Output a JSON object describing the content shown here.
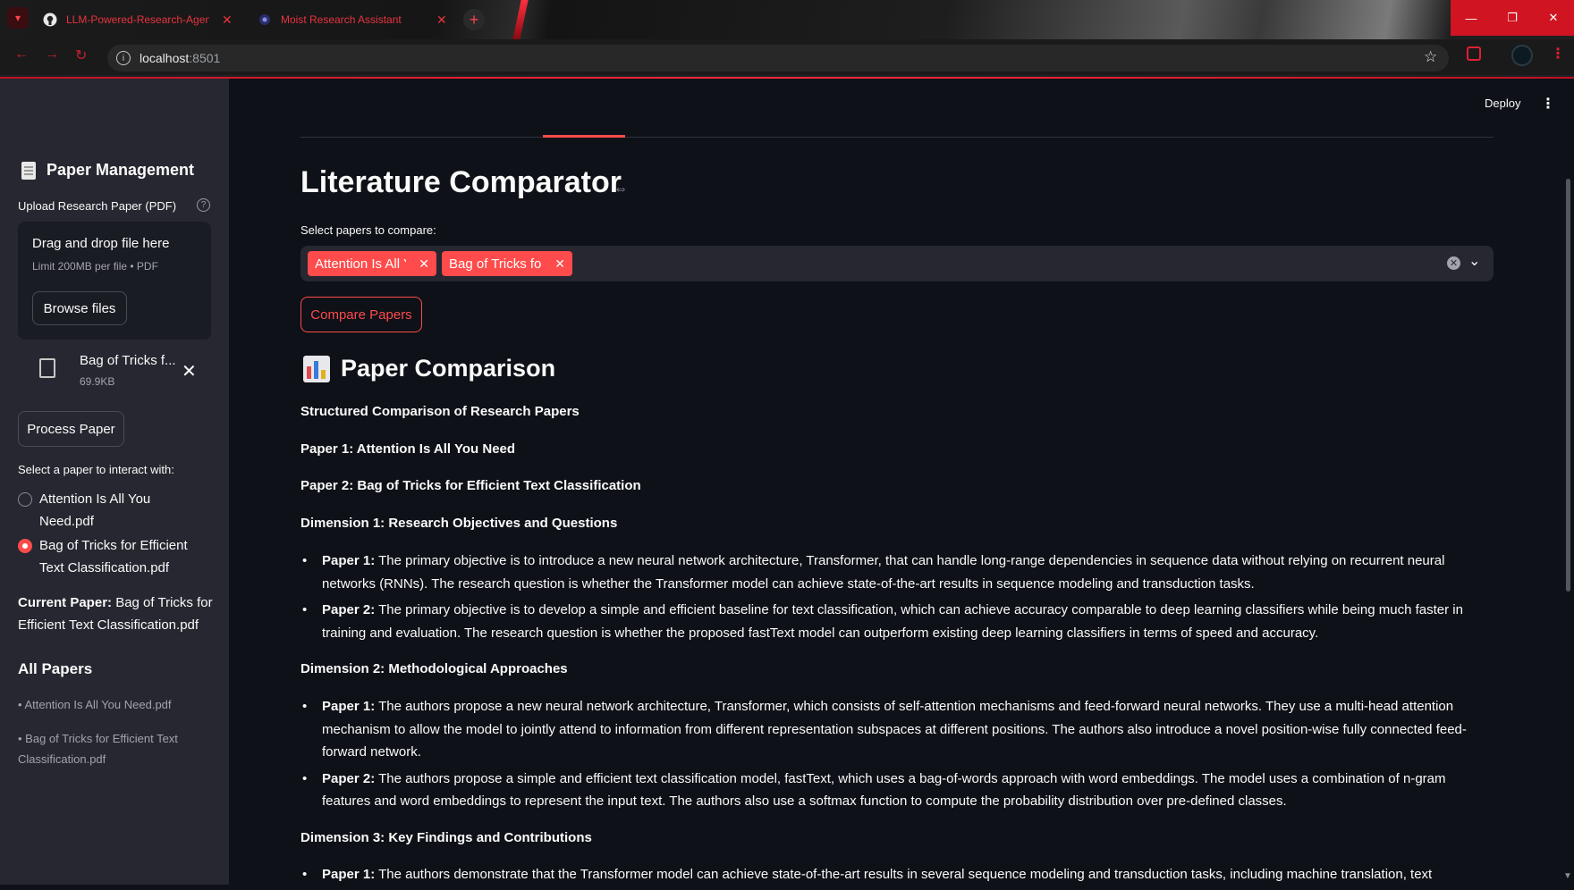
{
  "browser": {
    "tabs": [
      {
        "title": "LLM-Powered-Research-Agent",
        "icon": "github-icon"
      },
      {
        "title": "Moist Research Assistant",
        "icon": "streamlit-icon"
      }
    ],
    "new_tab": "+",
    "url": "localhost",
    "port": ":8501",
    "window": {
      "minimize": "—",
      "restore": "❐",
      "close": "✕"
    }
  },
  "sidebar": {
    "title": "Paper Management",
    "upload_label": "Upload Research Paper (PDF)",
    "dropzone": {
      "title": "Drag and drop file here",
      "subtitle": "Limit 200MB per file • PDF",
      "browse_label": "Browse files"
    },
    "uploaded_file": {
      "name": "Bag of Tricks f...",
      "size": "69.9KB"
    },
    "process_label": "Process Paper",
    "select_label": "Select a paper to interact with:",
    "radio_options": [
      {
        "label": "Attention Is All You Need.pdf",
        "selected": false
      },
      {
        "label": "Bag of Tricks for Efficient Text Classification.pdf",
        "selected": true
      }
    ],
    "current_paper_label": "Current Paper:",
    "current_paper_value": "Bag of Tricks for Efficient Text Classification.pdf",
    "all_papers_title": "All Papers",
    "all_papers": [
      "• Attention Is All You Need.pdf",
      "• Bag of Tricks for Efficient Text Classification.pdf"
    ]
  },
  "header": {
    "deploy_label": "Deploy",
    "menu_glyph": "⋮"
  },
  "main": {
    "title": "Literature Comparator",
    "select_label": "Select papers to compare:",
    "chips": [
      "Attention Is All Y...",
      "Bag of Tricks for ..."
    ],
    "compare_label": "Compare Papers",
    "section_title": "Paper Comparison",
    "heading": "Structured Comparison of Research Papers",
    "paper1": "Paper 1: Attention Is All You Need",
    "paper2": "Paper 2: Bag of Tricks for Efficient Text Classification",
    "dim1": {
      "title": "Dimension 1: Research Objectives and Questions",
      "p1_label": "Paper 1:",
      "p1_text": " The primary objective is to introduce a new neural network architecture, Transformer, that can handle long-range dependencies in sequence data without relying on recurrent neural networks (RNNs). The research question is whether the Transformer model can achieve state-of-the-art results in sequence modeling and transduction tasks.",
      "p2_label": "Paper 2:",
      "p2_text": " The primary objective is to develop a simple and efficient baseline for text classification, which can achieve accuracy comparable to deep learning classifiers while being much faster in training and evaluation. The research question is whether the proposed fastText model can outperform existing deep learning classifiers in terms of speed and accuracy."
    },
    "dim2": {
      "title": "Dimension 2: Methodological Approaches",
      "p1_label": "Paper 1:",
      "p1_text": " The authors propose a new neural network architecture, Transformer, which consists of self-attention mechanisms and feed-forward neural networks. They use a multi-head attention mechanism to allow the model to jointly attend to information from different representation subspaces at different positions. The authors also introduce a novel position-wise fully connected feed-forward network.",
      "p2_label": "Paper 2:",
      "p2_text": " The authors propose a simple and efficient text classification model, fastText, which uses a bag-of-words approach with word embeddings. The model uses a combination of n-gram features and word embeddings to represent the input text. The authors also use a softmax function to compute the probability distribution over pre-defined classes."
    },
    "dim3": {
      "title": "Dimension 3: Key Findings and Contributions",
      "p1_label": "Paper 1:",
      "p1_text": " The authors demonstrate that the Transformer model can achieve state-of-the-art results in several sequence modeling and transduction tasks, including machine translation, text"
    }
  },
  "colors": {
    "accent": "#ff4b4b",
    "sidebar_bg": "#262730",
    "main_bg": "#0e1117"
  }
}
